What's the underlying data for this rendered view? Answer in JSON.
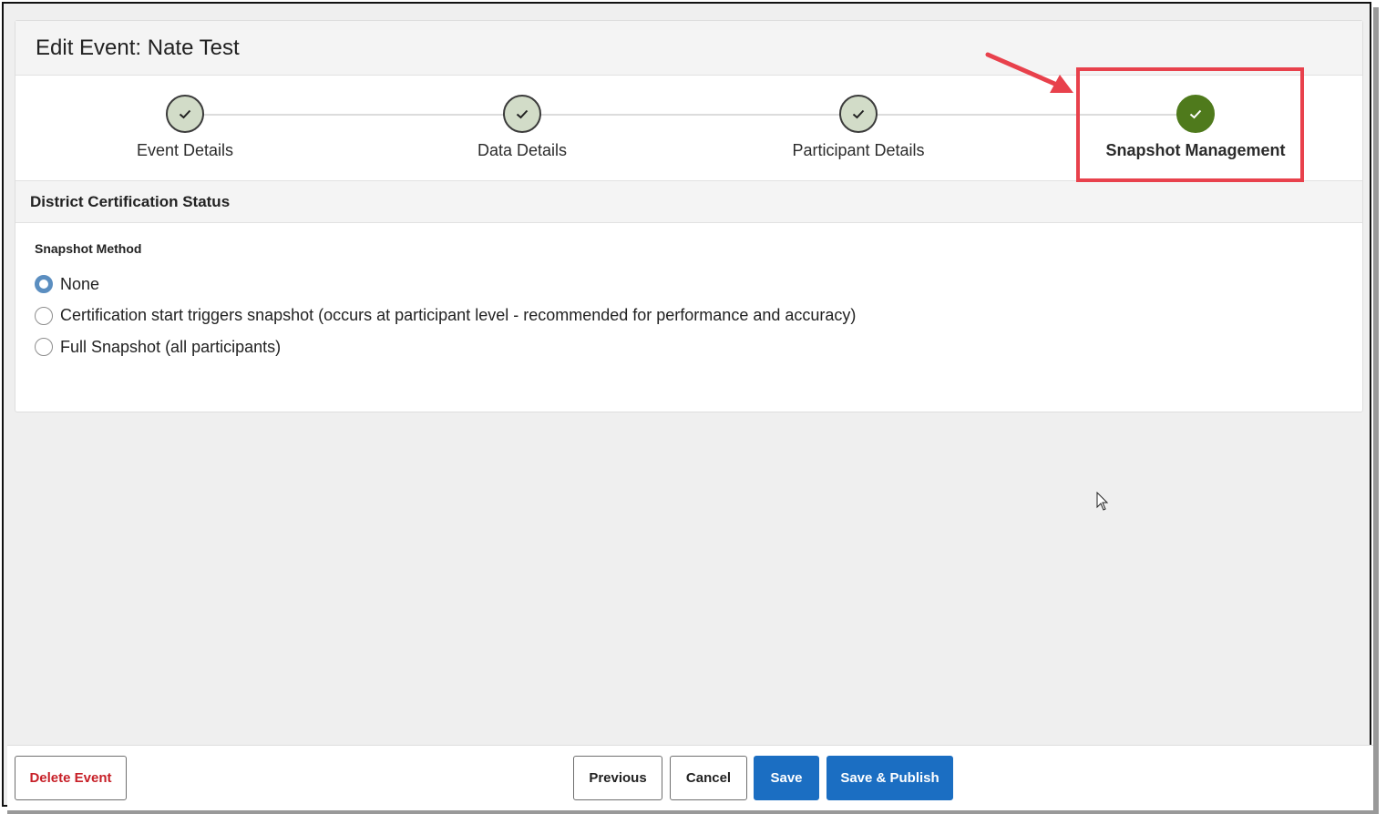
{
  "page": {
    "title": "Edit Event: Nate Test"
  },
  "steps": [
    {
      "label": "Event Details",
      "status": "complete"
    },
    {
      "label": "Data Details",
      "status": "complete"
    },
    {
      "label": "Participant Details",
      "status": "complete"
    },
    {
      "label": "Snapshot Management",
      "status": "current"
    }
  ],
  "section": {
    "title": "District Certification Status",
    "field_label": "Snapshot Method",
    "options": [
      {
        "label": "None",
        "selected": true
      },
      {
        "label": "Certification start triggers snapshot (occurs at participant level - recommended for performance and accuracy)",
        "selected": false
      },
      {
        "label": "Full Snapshot (all participants)",
        "selected": false
      }
    ]
  },
  "footer": {
    "delete_label": "Delete Event",
    "previous_label": "Previous",
    "cancel_label": "Cancel",
    "save_label": "Save",
    "save_publish_label": "Save & Publish"
  },
  "colors": {
    "step_complete": "#d2dcc8",
    "step_current": "#4f7a1c",
    "primary": "#1b6ec2",
    "danger": "#c72028",
    "annotation": "#e8414c"
  }
}
